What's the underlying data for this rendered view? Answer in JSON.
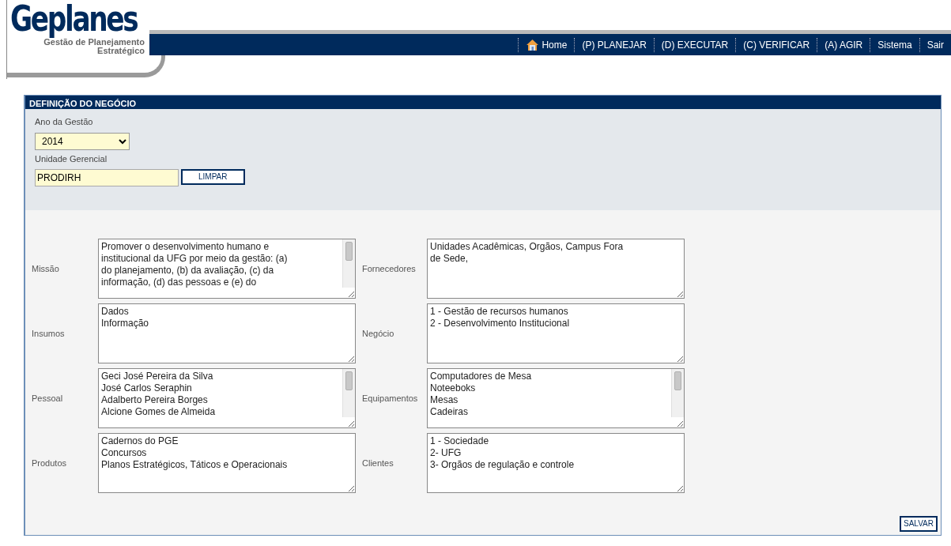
{
  "logo": {
    "title": "Geplanes",
    "subtitle_lines": [
      "Gestão de Planejamento",
      "Estratégico"
    ]
  },
  "menu": [
    {
      "label": "Home",
      "kind": "home"
    },
    {
      "label": "(P) PLANEJAR",
      "kind": "text"
    },
    {
      "label": "(D) EXECUTAR",
      "kind": "text"
    },
    {
      "label": "(C) VERIFICAR",
      "kind": "text"
    },
    {
      "label": "(A) AGIR",
      "kind": "text"
    },
    {
      "label": "Sistema",
      "kind": "text"
    },
    {
      "label": "Sair",
      "kind": "text"
    }
  ],
  "panel": {
    "title": "DEFINIÇÃO DO NEGÓCIO",
    "year": {
      "label": "Ano da Gestão",
      "value": "2014"
    },
    "unit": {
      "label": "Unidade Gerencial",
      "value": "PRODIRH",
      "button": "LIMPAR"
    },
    "fields": [
      {
        "label": "Missão",
        "scrollbar": true,
        "lines": [
          "Promover o desenvolvimento humano e",
          "institucional da UFG por meio da gestão: (a)",
          "do planejamento, (b) da avaliação, (c) da",
          "informação, (d) das pessoas e (e) do"
        ]
      },
      {
        "label": "Fornecedores",
        "scrollbar": false,
        "lines": [
          "Unidades Acadêmicas, Orgãos, Campus Fora",
          "de Sede,"
        ]
      },
      {
        "label": "Insumos",
        "scrollbar": false,
        "lines": [
          "Dados",
          "Informação"
        ]
      },
      {
        "label": "Negócio",
        "scrollbar": false,
        "lines": [
          "1 - Gestão de recursos humanos",
          "2 - Desenvolvimento Institucional"
        ]
      },
      {
        "label": "Pessoal",
        "scrollbar": true,
        "lines": [
          "Geci José Pereira da Silva",
          "José Carlos Seraphin",
          "Adalberto Pereira Borges",
          "Alcione Gomes de Almeida"
        ]
      },
      {
        "label": "Equipamentos",
        "scrollbar": true,
        "lines": [
          "Computadores de Mesa",
          "Noteeboks",
          "Mesas",
          "Cadeiras"
        ]
      },
      {
        "label": "Produtos",
        "scrollbar": false,
        "lines": [
          "Cadernos do PGE",
          "Concursos",
          "Planos Estratégicos, Táticos e Operacionais"
        ]
      },
      {
        "label": "Clientes",
        "scrollbar": false,
        "lines": [
          "1 - Sociedade",
          "2- UFG",
          "3- Orgãos de regulação e controle"
        ]
      }
    ],
    "save_button": "SALVAR"
  }
}
